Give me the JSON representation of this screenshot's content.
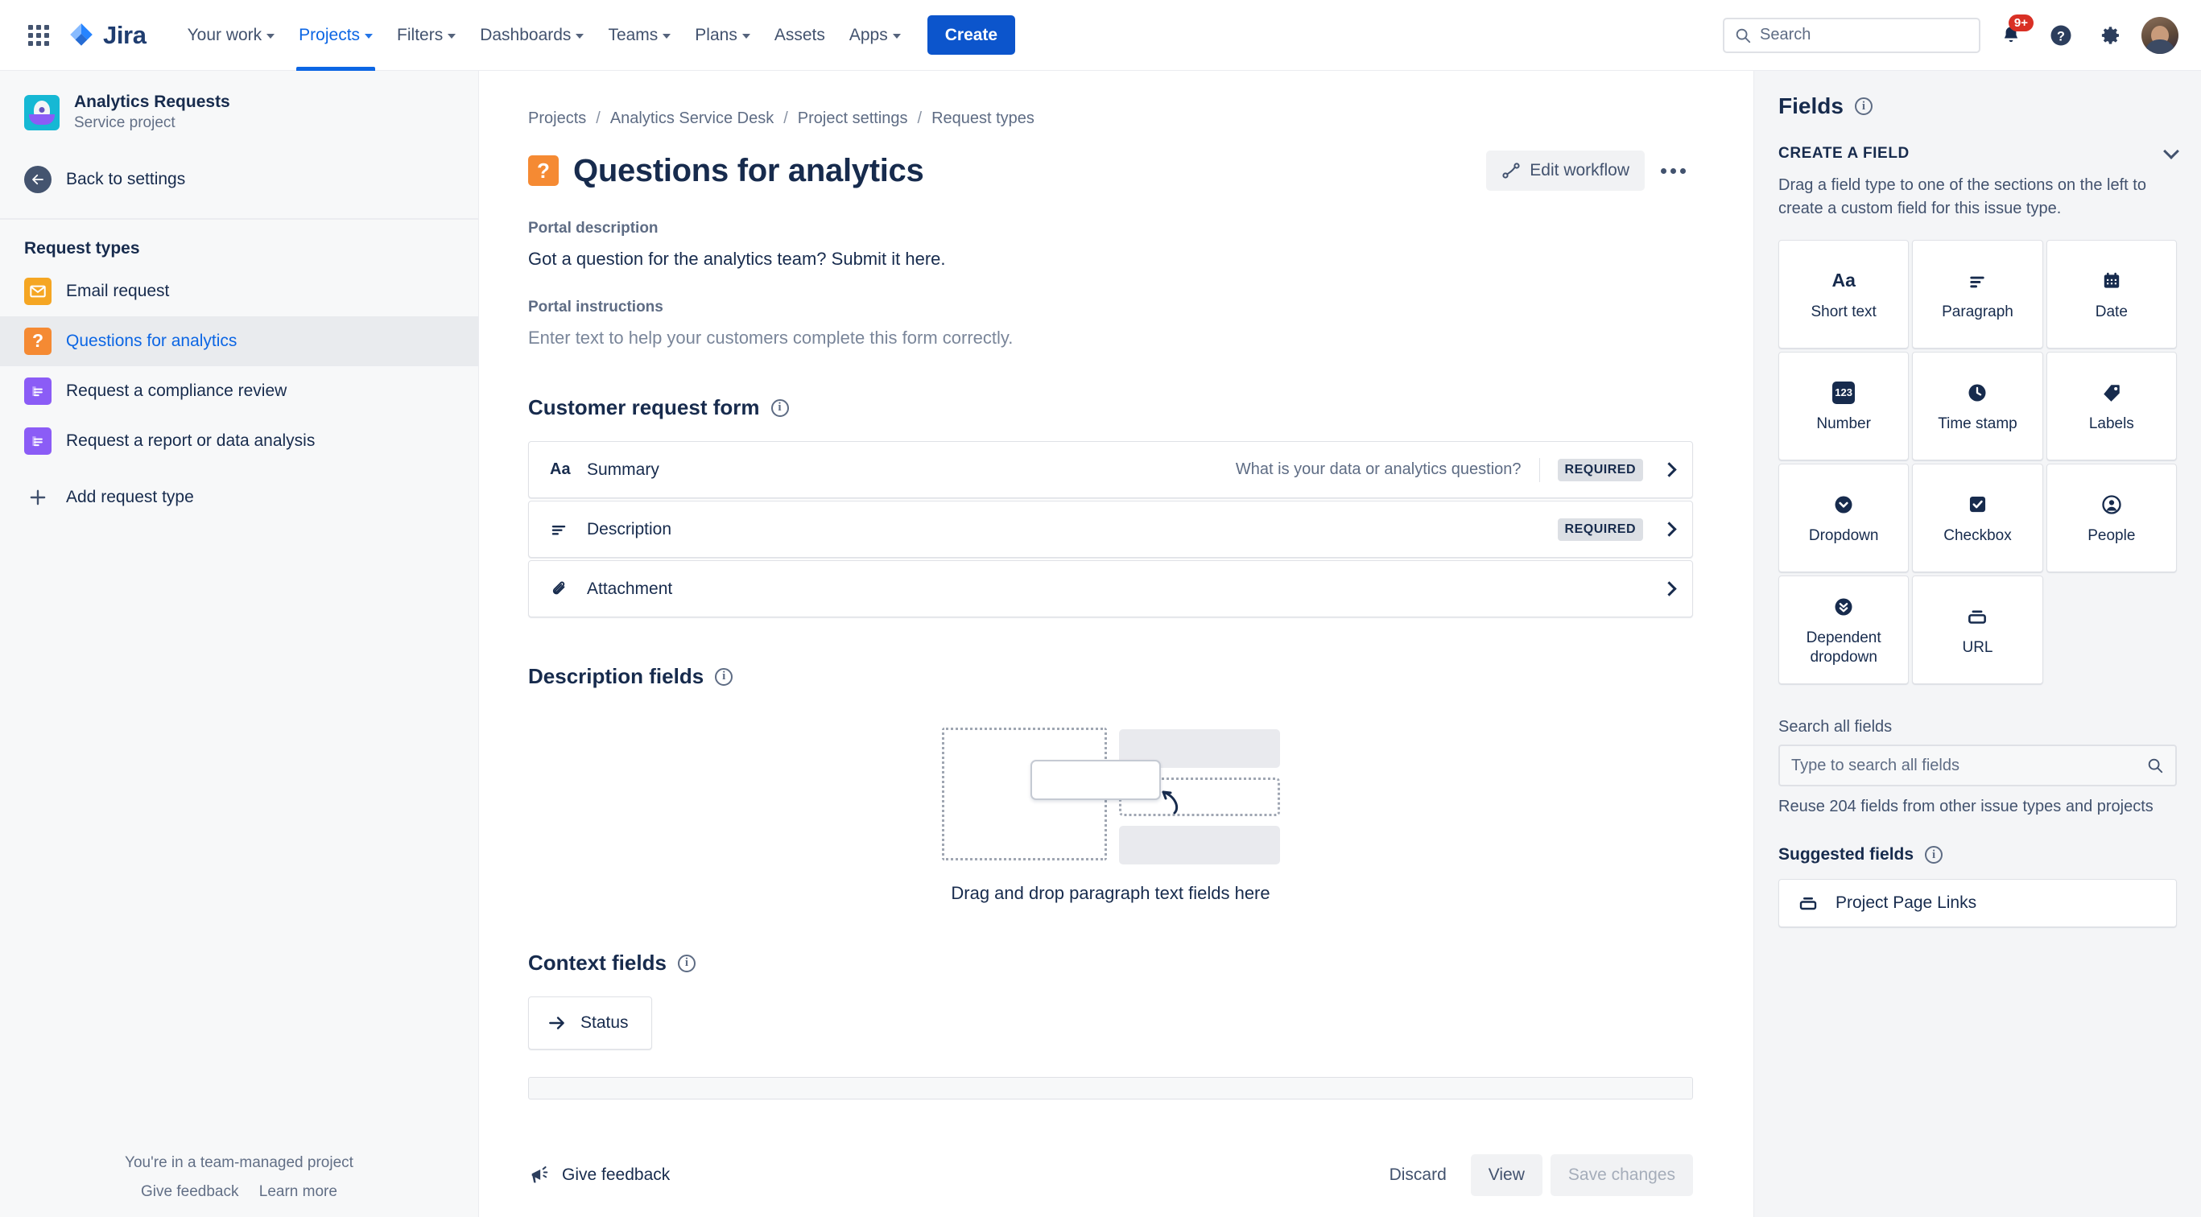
{
  "topnav": {
    "app_switcher_icon": "grid-apps-icon",
    "brand": "Jira",
    "items": [
      {
        "label": "Your work",
        "has_chevron": true,
        "active": false
      },
      {
        "label": "Projects",
        "has_chevron": true,
        "active": true
      },
      {
        "label": "Filters",
        "has_chevron": true,
        "active": false
      },
      {
        "label": "Dashboards",
        "has_chevron": true,
        "active": false
      },
      {
        "label": "Teams",
        "has_chevron": true,
        "active": false
      },
      {
        "label": "Plans",
        "has_chevron": true,
        "active": false
      },
      {
        "label": "Assets",
        "has_chevron": false,
        "active": false
      },
      {
        "label": "Apps",
        "has_chevron": true,
        "active": false
      }
    ],
    "create_label": "Create",
    "search_placeholder": "Search",
    "notification_badge": "9+",
    "icons": [
      "notification-bell-icon",
      "help-question-icon",
      "settings-gear-icon",
      "user-avatar"
    ]
  },
  "sidebar": {
    "project_name": "Analytics Requests",
    "project_type": "Service project",
    "back_label": "Back to settings",
    "section_title": "Request types",
    "request_types": [
      {
        "label": "Email request",
        "icon": "envelope-icon",
        "selected": false
      },
      {
        "label": "Questions for analytics",
        "icon": "question-mark-icon",
        "selected": true
      },
      {
        "label": "Request a compliance review",
        "icon": "document-lines-icon",
        "selected": false
      },
      {
        "label": "Request a report or data analysis",
        "icon": "document-lines-icon",
        "selected": false
      }
    ],
    "add_request_type": "Add request type",
    "footer_note": "You're in a team-managed project",
    "footer_links": [
      "Give feedback",
      "Learn more"
    ]
  },
  "main": {
    "breadcrumbs": [
      "Projects",
      "Analytics Service Desk",
      "Project settings",
      "Request types"
    ],
    "breadcrumb_separator": "/",
    "page_title": "Questions for analytics",
    "edit_workflow_label": "Edit workflow",
    "more_actions_label": "•••",
    "portal_description_label": "Portal description",
    "portal_description_value": "Got a question for the analytics team? Submit it here.",
    "portal_instructions_label": "Portal instructions",
    "portal_instructions_value": "Enter text to help your customers complete this form correctly.",
    "customer_request_form": {
      "title": "Customer request form",
      "rows": [
        {
          "icon": "short-text-aa-icon",
          "label": "Summary",
          "description": "What is your data or analytics question?",
          "badge": "REQUIRED"
        },
        {
          "icon": "paragraph-lines-icon",
          "label": "Description",
          "description": "",
          "badge": "REQUIRED"
        },
        {
          "icon": "paperclip-icon",
          "label": "Attachment",
          "description": "",
          "badge": ""
        }
      ]
    },
    "description_fields": {
      "title": "Description fields",
      "empty_text": "Drag and drop paragraph text fields here"
    },
    "context_fields": {
      "title": "Context fields",
      "chips": [
        {
          "icon": "arrow-right-icon",
          "label": "Status"
        }
      ]
    },
    "footer": {
      "give_feedback": "Give feedback",
      "discard": "Discard",
      "view": "View",
      "save_changes": "Save changes"
    }
  },
  "rightpanel": {
    "title": "Fields",
    "create_section_title": "CREATE A FIELD",
    "create_section_desc": "Drag a field type to one of the sections on the left to create a custom field for this issue type.",
    "field_types": [
      {
        "label": "Short text",
        "icon": "aa-text-icon"
      },
      {
        "label": "Paragraph",
        "icon": "paragraph-lines-icon"
      },
      {
        "label": "Date",
        "icon": "calendar-icon"
      },
      {
        "label": "Number",
        "icon": "number-123-icon"
      },
      {
        "label": "Time stamp",
        "icon": "clock-icon"
      },
      {
        "label": "Labels",
        "icon": "tag-icon"
      },
      {
        "label": "Dropdown",
        "icon": "chevron-down-circle-icon"
      },
      {
        "label": "Checkbox",
        "icon": "checkbox-checked-icon"
      },
      {
        "label": "People",
        "icon": "person-circle-icon"
      },
      {
        "label": "Dependent dropdown",
        "icon": "double-chevron-down-circle-icon"
      },
      {
        "label": "URL",
        "icon": "url-link-icon"
      }
    ],
    "search_label": "Search all fields",
    "search_placeholder": "Type to search all fields",
    "reuse_hint": "Reuse 204 fields from other issue types and projects",
    "suggested_title": "Suggested fields",
    "suggested": [
      {
        "label": "Project Page Links",
        "icon": "url-link-icon"
      }
    ]
  },
  "colors": {
    "brand_blue": "#0C66E4",
    "create_blue": "#0C55CC",
    "text": "#172B4D",
    "muted": "#5E6C84",
    "sidebar_bg": "#F7F8F9",
    "panel_bg": "#F4F5F7",
    "orange": "#F58A33",
    "purple": "#8B5CF6",
    "badge_red": "#D93025"
  }
}
